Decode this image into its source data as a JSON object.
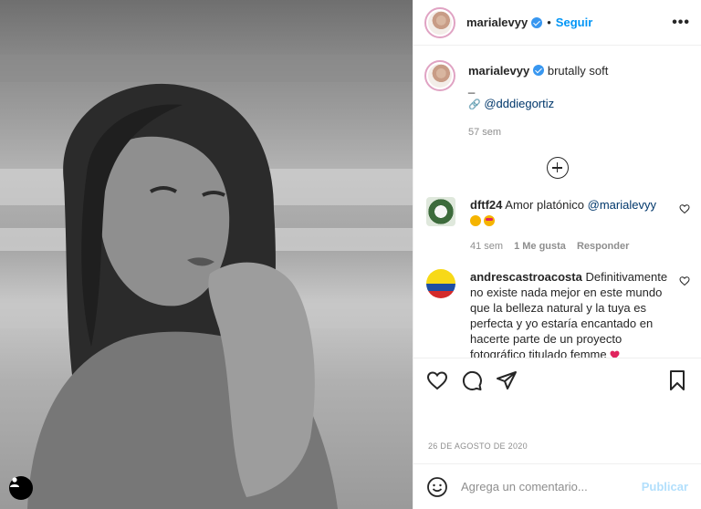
{
  "post": {
    "photo_alt": "black and white portrait on beach",
    "author": {
      "username": "marialevyy",
      "verified": true
    },
    "header": {
      "separator": "•",
      "follow_label": "Seguir",
      "more_icon": "more-horizontal-icon"
    },
    "caption": {
      "text": "brutally soft",
      "line2": "_",
      "credit_mention": "@dddiegortiz",
      "age": "57 sem"
    },
    "comments": [
      {
        "username": "dftf24",
        "text": "Amor platónico",
        "mention": "@marialevyy",
        "age": "41 sem",
        "likes": "1 Me gusta",
        "reply_label": "Responder"
      },
      {
        "username": "andrescastroacosta",
        "text": "Definitivamente no existe nada mejor en este mundo que la belleza natural y la tuya es perfecta y yo estaría encantado en hacerte parte de un proyecto fotográfico titulado femme"
      }
    ],
    "date": "26 DE AGOSTO DE 2020",
    "composer": {
      "placeholder": "Agrega un comentario...",
      "publish_label": "Publicar"
    },
    "colors": {
      "accent": "#0095f6",
      "verified": "#3897f0",
      "publish_disabled": "#b2dffc"
    }
  }
}
